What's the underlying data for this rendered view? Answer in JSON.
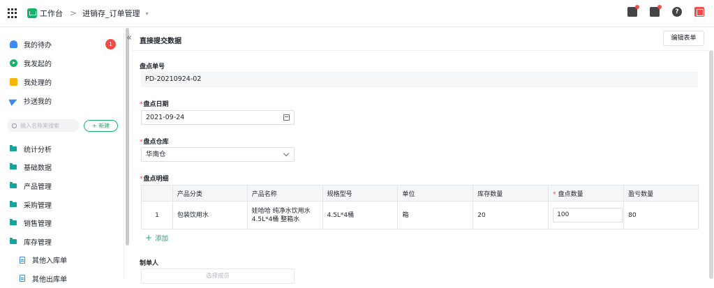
{
  "topbar": {
    "apps_icon": "grid-icon",
    "app_name": "工作台",
    "breadcrumb_sep": ">",
    "current_app": "进销存_订单管理",
    "caret": "▾",
    "right_icons": [
      "notification-box-icon",
      "bell-icon",
      "help-icon",
      "user-icon"
    ],
    "help_glyph": "?"
  },
  "sidebar": {
    "quick_items": [
      {
        "label": "我的待办",
        "icon": "bell-icon",
        "badge": "1"
      },
      {
        "label": "我发起的",
        "icon": "play-icon"
      },
      {
        "label": "我处理的",
        "icon": "task-icon"
      },
      {
        "label": "抄送我的",
        "icon": "send-icon"
      }
    ],
    "search_placeholder": "输入名称来搜索",
    "new_button": "+ 新建",
    "menu": [
      {
        "label": "统计分析"
      },
      {
        "label": "基础数据"
      },
      {
        "label": "产品管理"
      },
      {
        "label": "采购管理"
      },
      {
        "label": "销售管理"
      },
      {
        "label": "库存管理"
      }
    ],
    "sub_menu": [
      {
        "label": "其他入库单"
      },
      {
        "label": "其他出库单"
      }
    ]
  },
  "main": {
    "collapse_glyph": "«",
    "title": "直接提交数据",
    "edit_button": "编辑表单",
    "fields": {
      "order_no_label": "盘点单号",
      "order_no_value": "PD-20210924-02",
      "date_label": "盘点日期",
      "date_value": "2021-09-24",
      "warehouse_label": "盘点仓库",
      "warehouse_value": "华南仓",
      "details_label": "盘点明细",
      "maker_label": "制单人",
      "maker_placeholder": "选择成员"
    },
    "required_mark": "*",
    "table": {
      "headers": [
        "",
        "产品分类",
        "产品名称",
        "规格型号",
        "单位",
        "库存数量",
        "盘点数量",
        "盈亏数量"
      ],
      "rows": [
        {
          "idx": "1",
          "category": "包装饮用水",
          "name": "娃哈哈 纯净水饮用水 4.5L*4桶 整箱水",
          "spec": "4.5L*4桶",
          "unit": "箱",
          "stock": "20",
          "count": "100",
          "diff": "80"
        }
      ]
    },
    "add_row": "添加",
    "add_glyph": "+"
  }
}
